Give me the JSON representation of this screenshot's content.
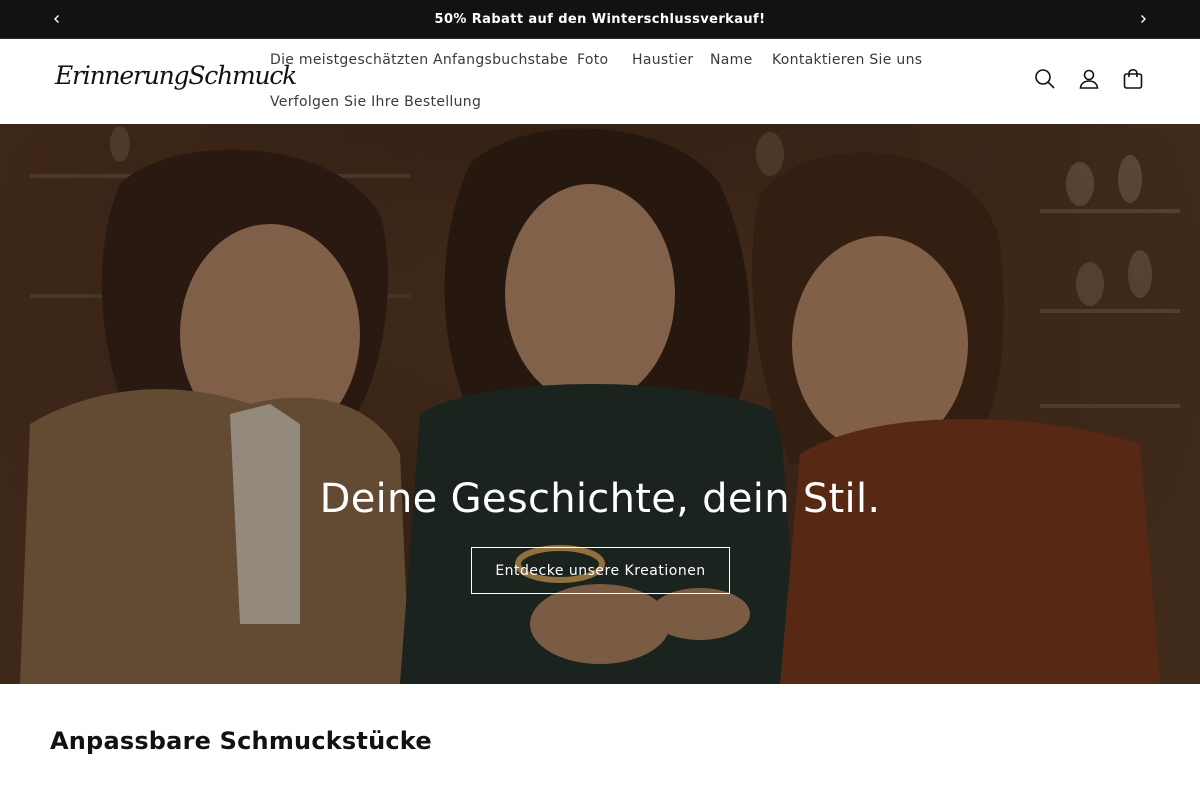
{
  "announcement": {
    "text": "50% Rabatt auf den Winterschlussverkauf!",
    "prev_icon": "chevron-left-icon",
    "next_icon": "chevron-right-icon"
  },
  "header": {
    "logo_text": "ErinnerungSchmuck",
    "nav": [
      {
        "label": "Die meistgeschätzten"
      },
      {
        "label": "Anfangsbuchstabe"
      },
      {
        "label": "Foto"
      },
      {
        "label": "Haustier"
      },
      {
        "label": "Name"
      },
      {
        "label": "Kontaktieren Sie uns"
      },
      {
        "label": "Verfolgen Sie Ihre Bestellung"
      }
    ],
    "icons": [
      "search-icon",
      "account-icon",
      "cart-icon"
    ]
  },
  "hero": {
    "title": "Deine Geschichte, dein Stil.",
    "button_label": "Entdecke unsere Kreationen"
  },
  "section": {
    "title": "Anpassbare Schmuckstücke"
  },
  "colors": {
    "announcement_bg": "#121212",
    "text": "#121212",
    "hero_overlay": "#2a1a10"
  }
}
